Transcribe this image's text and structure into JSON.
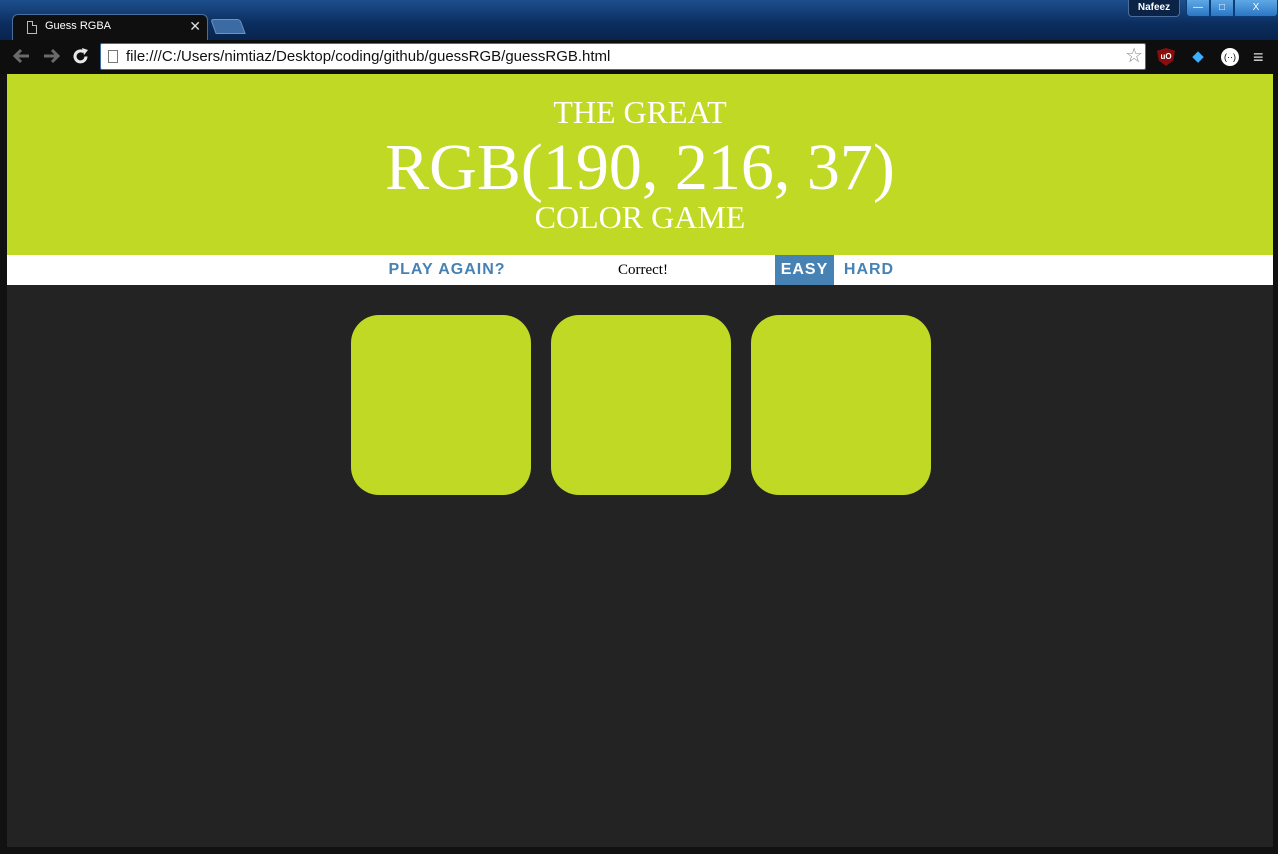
{
  "browser": {
    "tab_title": "Guess RGBA",
    "tab_close": "✕",
    "user_name": "Nafeez",
    "url": "file:///C:/Users/nimtiaz/Desktop/coding/github/guessRGB/guessRGB.html",
    "window_controls": {
      "minimize": "—",
      "maximize": "□",
      "close": "X"
    },
    "extensions": {
      "ublock": "uO",
      "drop": "◆",
      "circle": "(··)",
      "menu": "≡"
    }
  },
  "game": {
    "header": {
      "line1": "THE GREAT",
      "line2": "RGB(190, 216, 37)",
      "line3": "COLOR GAME"
    },
    "controls": {
      "reset_label": "PLAY AGAIN?",
      "message": "Correct!",
      "easy_label": "EASY",
      "hard_label": "HARD",
      "selected_mode": "EASY"
    },
    "squares": [
      {
        "color": "#bfd925"
      },
      {
        "color": "#bfd925"
      },
      {
        "color": "#bfd925"
      }
    ],
    "colors": {
      "header_bg": "#bfd925",
      "body_bg": "#232323",
      "accent": "#4682b4"
    }
  }
}
